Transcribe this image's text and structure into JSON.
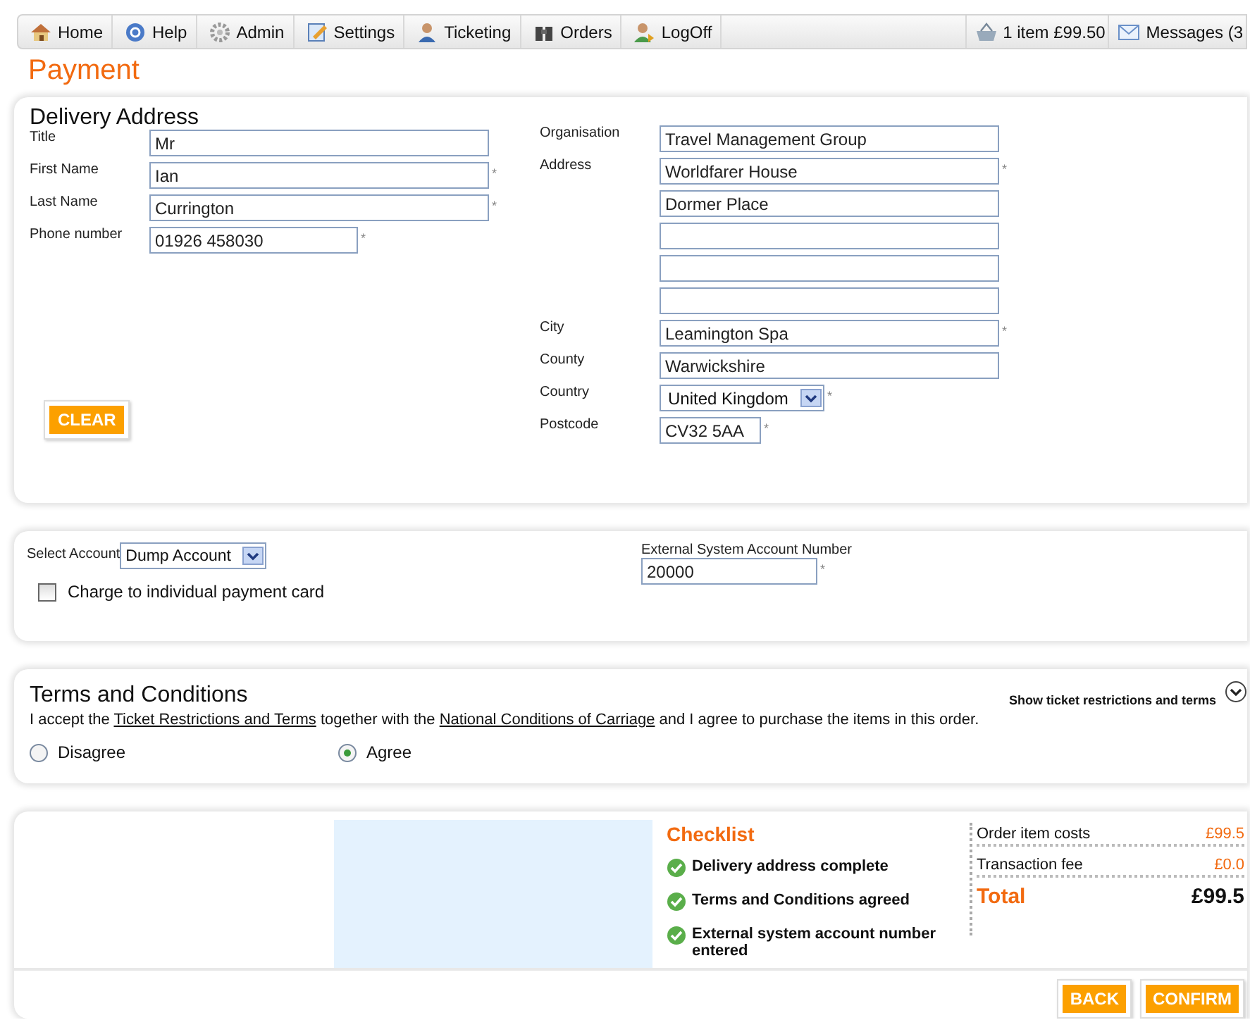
{
  "nav": {
    "items": [
      {
        "label": "Home"
      },
      {
        "label": "Help"
      },
      {
        "label": "Admin"
      },
      {
        "label": "Settings"
      },
      {
        "label": "Ticketing"
      },
      {
        "label": "Orders"
      },
      {
        "label": "LogOff"
      }
    ],
    "right": [
      {
        "label": "1 item £99.50"
      },
      {
        "label": "Messages (3"
      }
    ]
  },
  "page_title": "Payment",
  "delivery": {
    "title": "Delivery Address",
    "left_fields": [
      {
        "label": "Title",
        "value": "Mr"
      },
      {
        "label": "First Name",
        "value": "Ian",
        "required_mark": "*"
      },
      {
        "label": "Last Name",
        "value": "Currington",
        "required_mark": "*"
      },
      {
        "label": "Phone number",
        "value": "01926 458030",
        "required_mark": "*"
      }
    ],
    "right_fields": [
      {
        "kind": "text",
        "label": "Organisation",
        "value": "Travel Management Group"
      },
      {
        "kind": "text",
        "label": "Address",
        "value": "Worldfarer House",
        "required_mark": "*"
      },
      {
        "kind": "text",
        "value": "Dormer Place"
      },
      {
        "kind": "text"
      },
      {
        "kind": "text"
      },
      {
        "kind": "text"
      },
      {
        "kind": "text",
        "label": "City",
        "value": "Leamington Spa",
        "required_mark": "*"
      },
      {
        "kind": "text",
        "label": "County",
        "value": "Warwickshire"
      },
      {
        "kind": "select",
        "label": "Country",
        "value": "United Kingdom",
        "required_mark": "*"
      },
      {
        "kind": "short",
        "label": "Postcode",
        "value": "CV32 5AA",
        "required_mark": "*"
      }
    ],
    "clear_button": "CLEAR"
  },
  "account": {
    "select_label": "Select Account",
    "select_value": "Dump Account",
    "charge_card": {
      "label": "Charge to individual payment card",
      "checked": false
    },
    "external": {
      "label": "External System Account Number",
      "value": "20000",
      "required_mark": "*"
    }
  },
  "terms": {
    "title": "Terms and Conditions",
    "toggle": "Show ticket restrictions and terms",
    "sentence": [
      "I accept the ",
      {
        "link": "Ticket Restrictions and Terms"
      },
      " together with the ",
      {
        "link": "National Conditions of Carriage"
      },
      " and I agree to purchase the items in this order."
    ],
    "options": [
      {
        "label": "Disagree",
        "selected": false
      },
      {
        "label": "Agree",
        "selected": true
      }
    ]
  },
  "summary": {
    "checklist_title": "Checklist",
    "checklist": [
      {
        "label": "Delivery address complete",
        "done": true
      },
      {
        "label": "Terms and Conditions agreed",
        "done": true
      },
      {
        "label": "External system account number entered",
        "done": true
      }
    ],
    "costs": [
      {
        "label": "Order item costs",
        "value": "£99.5"
      },
      {
        "label": "Transaction fee",
        "value": "£0.0"
      }
    ],
    "total": {
      "label": "Total",
      "value": "£99.5"
    }
  },
  "buttons": [
    {
      "label": "BACK"
    },
    {
      "label": "CONFIRM"
    }
  ]
}
